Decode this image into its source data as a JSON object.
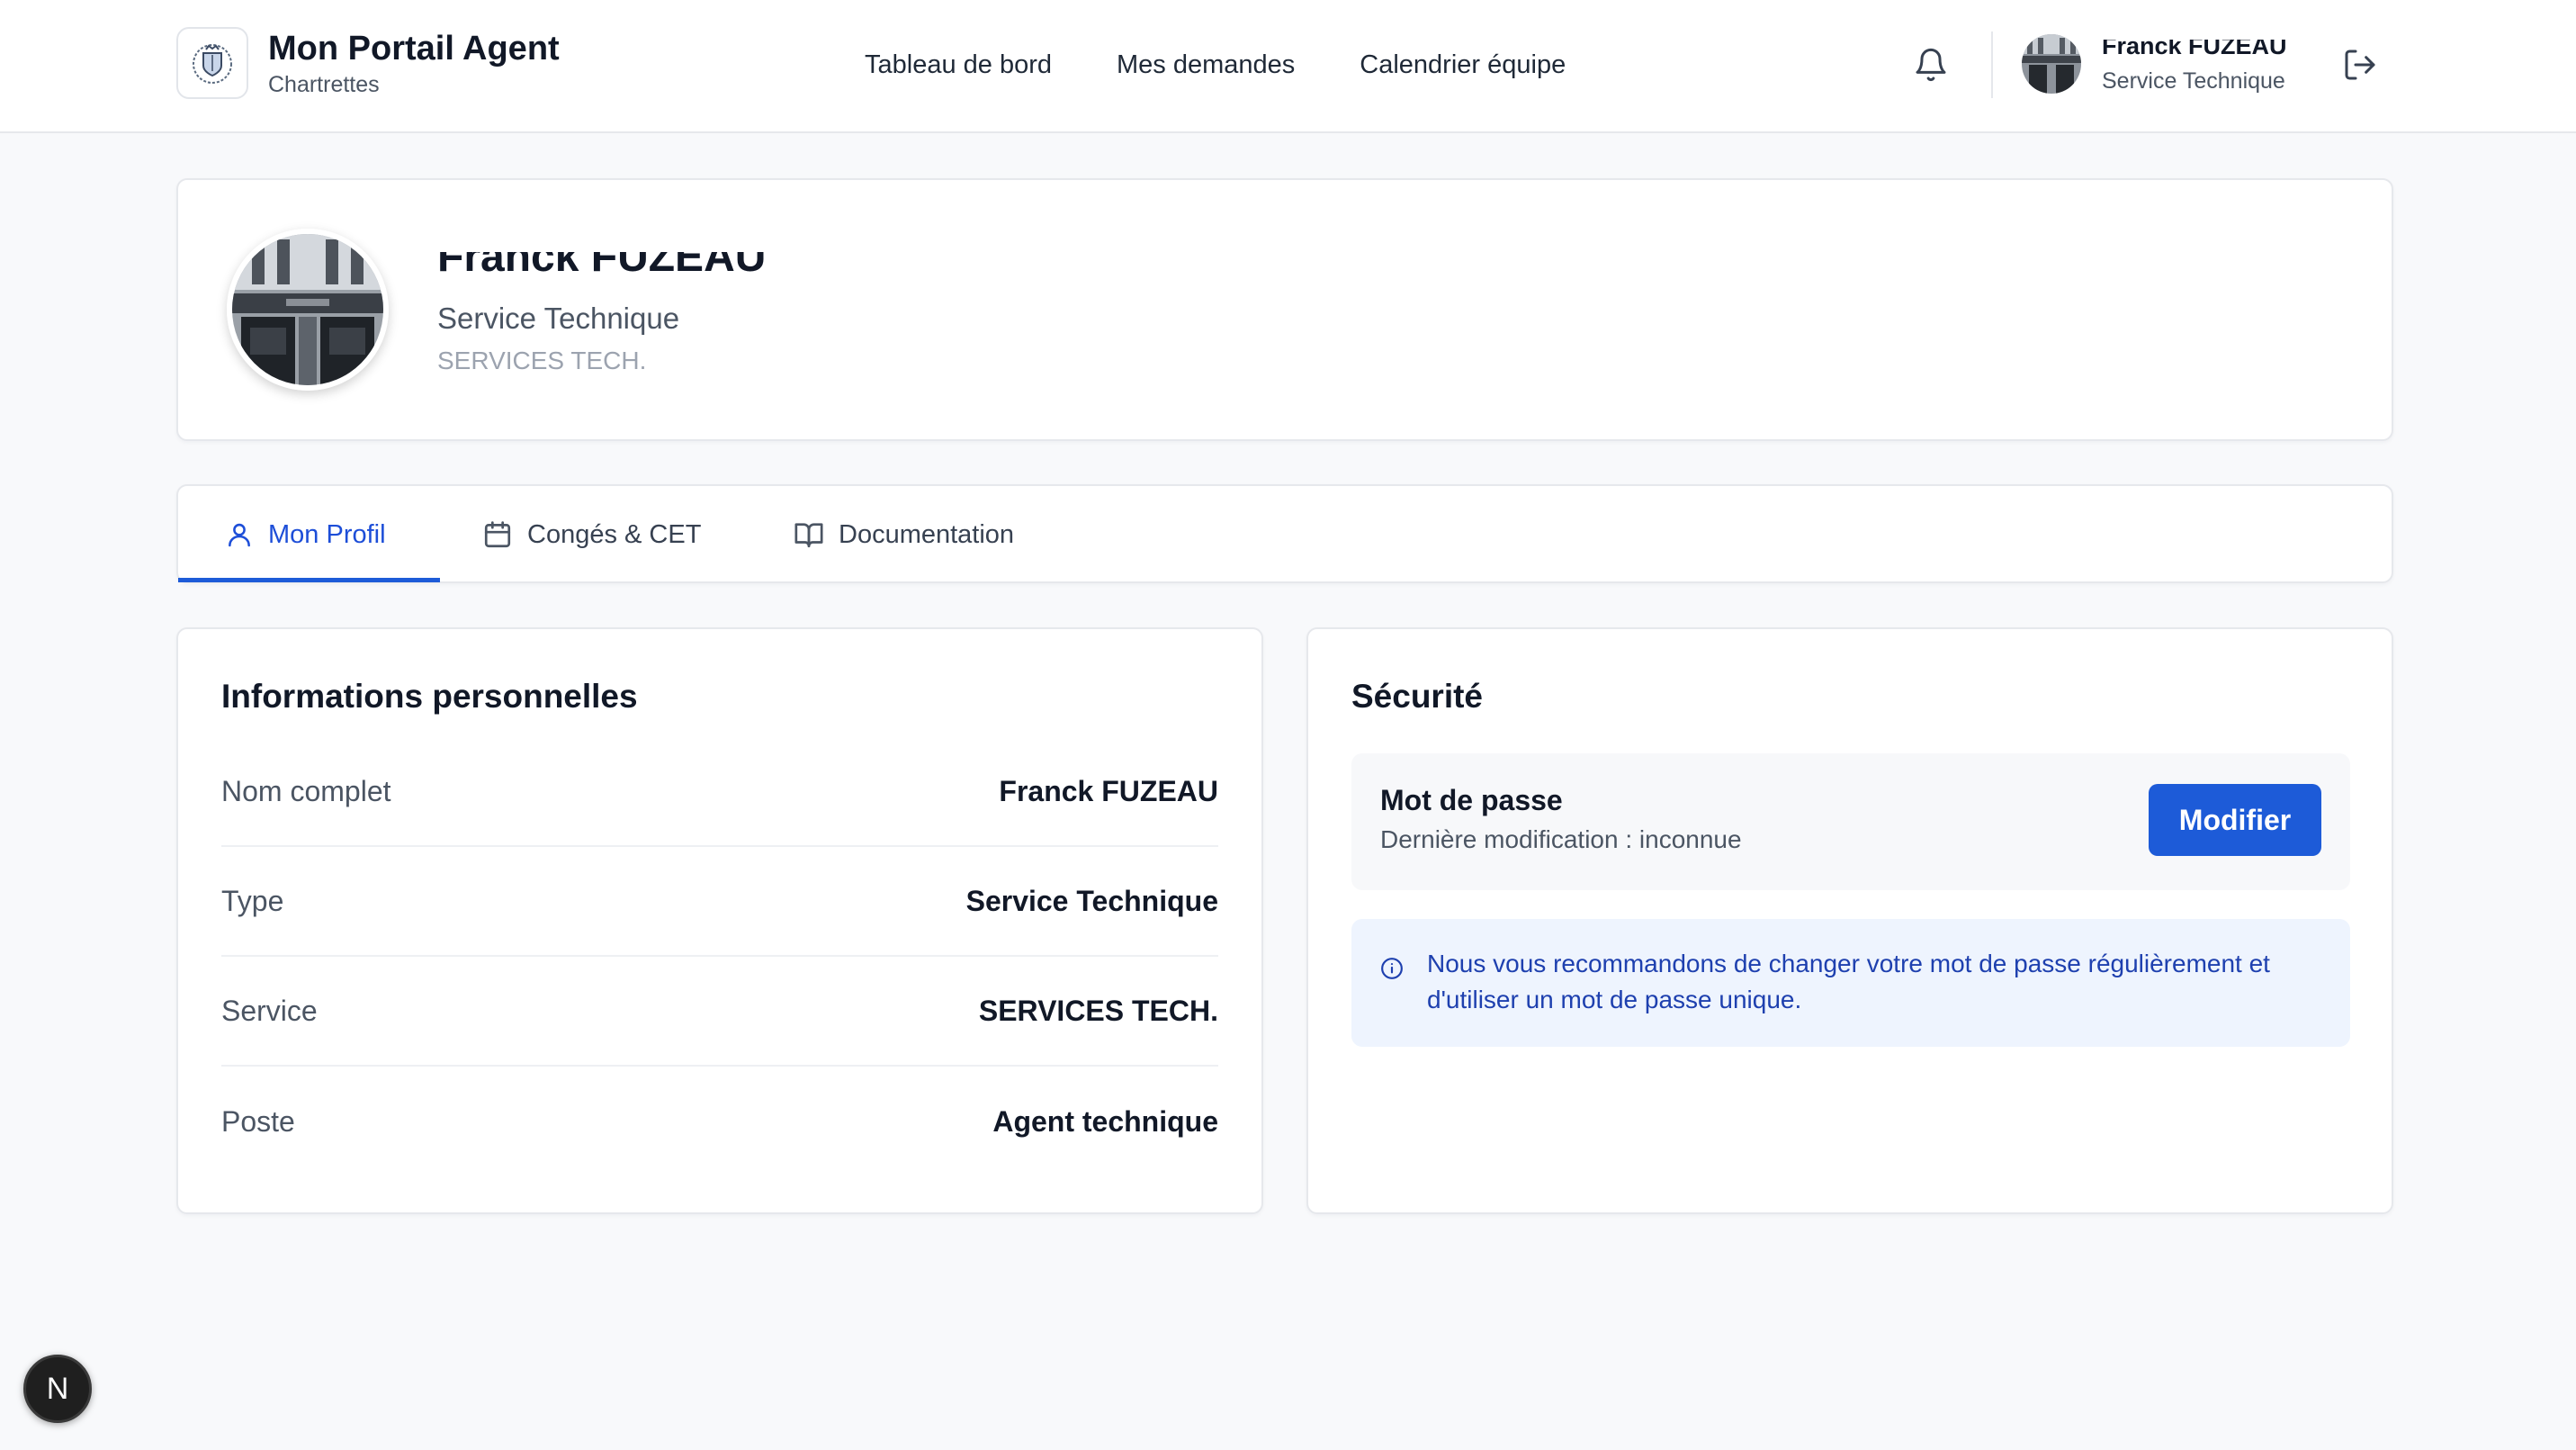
{
  "header": {
    "app_title": "Mon Portail Agent",
    "app_subtitle": "Chartrettes",
    "nav": [
      {
        "label": "Tableau de bord"
      },
      {
        "label": "Mes demandes"
      },
      {
        "label": "Calendrier équipe"
      }
    ],
    "user": {
      "name": "Franck FUZEAU",
      "role": "Service Technique"
    }
  },
  "profile": {
    "name": "Franck FUZEAU",
    "type": "Service Technique",
    "service": "SERVICES TECH."
  },
  "tabs": [
    {
      "label": "Mon Profil",
      "active": true
    },
    {
      "label": "Congés & CET",
      "active": false
    },
    {
      "label": "Documentation",
      "active": false
    }
  ],
  "info": {
    "title": "Informations personnelles",
    "rows": [
      {
        "label": "Nom complet",
        "value": "Franck FUZEAU"
      },
      {
        "label": "Type",
        "value": "Service Technique"
      },
      {
        "label": "Service",
        "value": "SERVICES TECH."
      },
      {
        "label": "Poste",
        "value": "Agent technique"
      }
    ]
  },
  "security": {
    "title": "Sécurité",
    "password_title": "Mot de passe",
    "password_sub": "Dernière modification : inconnue",
    "modify_label": "Modifier",
    "notice": "Nous vous recommandons de changer votre mot de passe régulièrement et d'utiliser un mot de passe unique."
  },
  "dev_badge": "N",
  "colors": {
    "primary": "#1d5bd8",
    "notice_bg": "#eef4fe",
    "notice_text": "#1e40af",
    "page_bg": "#f8f9fb"
  }
}
